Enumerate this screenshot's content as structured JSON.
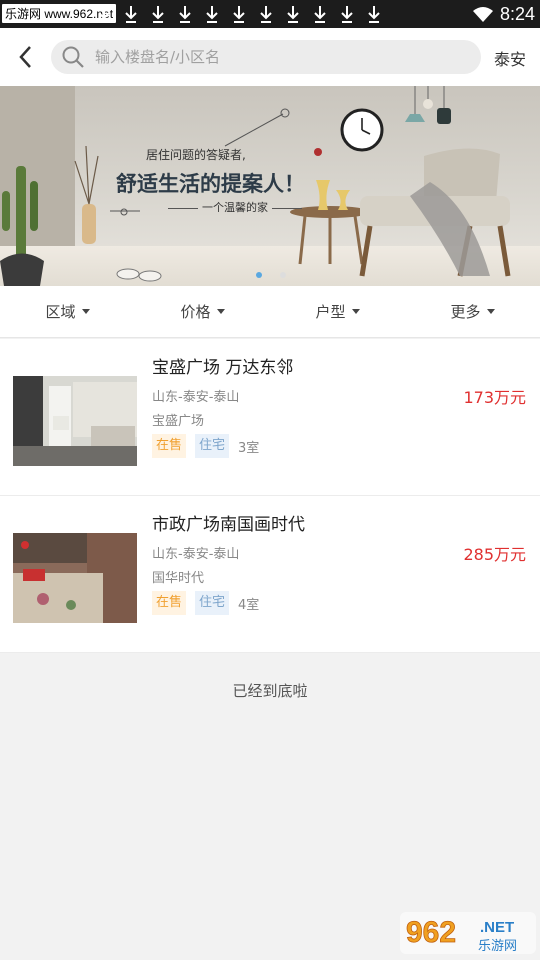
{
  "status_bar": {
    "watermark": "乐游网 www.962.net",
    "time": "8:24"
  },
  "header": {
    "search_placeholder": "输入楼盘名/小区名",
    "city": "泰安"
  },
  "banner": {
    "line1": "居住问题的答疑者,",
    "line2": "舒适生活的提案人！",
    "line3": "一个温馨的家",
    "active_index": 0,
    "slide_count": 2
  },
  "filters": [
    "区域",
    "价格",
    "户型",
    "更多"
  ],
  "listings": [
    {
      "title": "宝盛广场  万达东邻",
      "location": "山东-泰安-泰山",
      "estate": "宝盛广场",
      "price": "173万元",
      "status_tag": "在售",
      "type_tag": "住宅",
      "rooms": "3室"
    },
    {
      "title": "市政广场南国画时代",
      "location": "山东-泰安-泰山",
      "estate": "国华时代",
      "price": "285万元",
      "status_tag": "在售",
      "type_tag": "住宅",
      "rooms": "4室"
    }
  ],
  "end_text": "已经到底啦",
  "corner_watermark": {
    "number": "962",
    "suffix": ".NET",
    "name": "乐游网"
  },
  "colors": {
    "price": "#e03030",
    "sale_tag": "#f0a030",
    "type_tag": "#7fa6cc",
    "dot_active": "#5aa8e0"
  }
}
